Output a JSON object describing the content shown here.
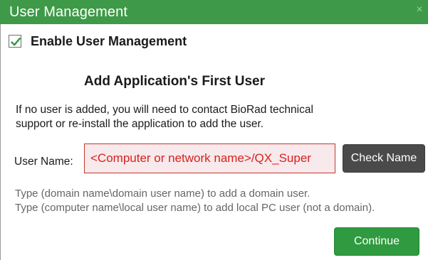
{
  "window": {
    "title": "User Management",
    "close_symbol": "×"
  },
  "enable": {
    "label": "Enable User Management",
    "checked": true
  },
  "section": {
    "heading": "Add Application's First User",
    "info_line1": "If no user is added, you will need to contact BioRad technical",
    "info_line2": "support or re-install the application to add the user."
  },
  "user": {
    "label": "User Name:",
    "value": "<Computer or network name>/QX_Super",
    "check_button": "Check Name"
  },
  "hints": {
    "line1": "Type (domain name\\domain user name) to add a domain user.",
    "line2": "Type (computer name\\local user name) to add local PC user (not a domain)."
  },
  "footer": {
    "continue_button": "Continue"
  },
  "colors": {
    "titlebar": "#3e9a48",
    "continue": "#2f9a3f",
    "check_button": "#4a4a4a",
    "input_text": "#d9221c",
    "input_bg": "#f7e9ec",
    "checkmark": "#2e9a3c"
  },
  "icons": {
    "close": "close-icon",
    "check": "checkmark-icon"
  }
}
